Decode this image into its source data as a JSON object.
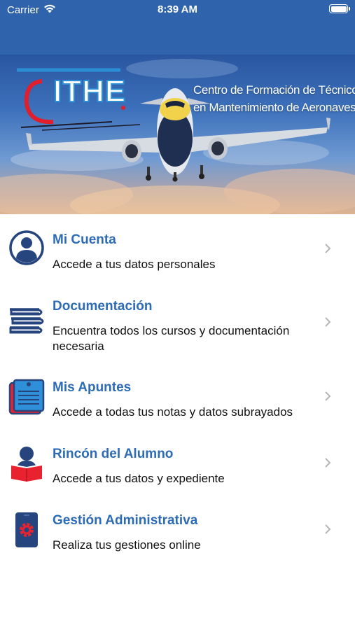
{
  "status_bar": {
    "carrier": "Carrier",
    "time": "8:39 AM"
  },
  "banner": {
    "logo_text": "ITHE",
    "tagline_line1": "Centro de Formación de Técnicos",
    "tagline_line2": "en Mantenimiento de Aeronaves"
  },
  "menu": {
    "items": [
      {
        "title": "Mi Cuenta",
        "description": "Accede a tus datos personales",
        "icon": "user-icon"
      },
      {
        "title": "Documentación",
        "description": "Encuentra todos los cursos y documentación necesaria",
        "icon": "books-icon"
      },
      {
        "title": "Mis Apuntes",
        "description": "Accede a todas tus notas y datos subrayados",
        "icon": "notepad-icon"
      },
      {
        "title": "Rincón del Alumno",
        "description": "Accede a tus datos y expediente",
        "icon": "student-icon"
      },
      {
        "title": "Gestión Administrativa",
        "description": "Realiza tus gestiones online",
        "icon": "settings-phone-icon"
      }
    ]
  },
  "colors": {
    "header_blue": "#2f64ad",
    "title_blue": "#2d6bb5",
    "icon_navy": "#26457f",
    "icon_red": "#e8232f"
  }
}
